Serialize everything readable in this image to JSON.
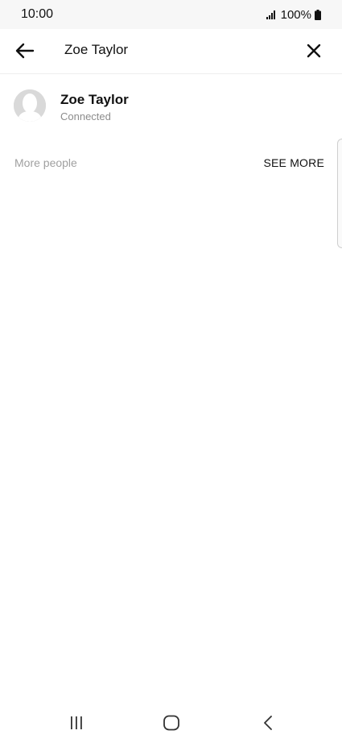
{
  "status_bar": {
    "time": "10:00",
    "battery": "100%",
    "icons": [
      "signal-icon",
      "battery-icon"
    ]
  },
  "search": {
    "query": "Zoe Taylor",
    "back_icon": "arrow-left-icon",
    "close_icon": "close-icon"
  },
  "results": [
    {
      "name": "Zoe Taylor",
      "status": "Connected",
      "avatar_icon": "default-avatar-icon"
    }
  ],
  "more_people": {
    "label": "More people",
    "action": "SEE MORE"
  },
  "nav_bar": {
    "icons": [
      "recent-apps-icon",
      "home-icon",
      "back-icon"
    ]
  },
  "colors": {
    "background": "#ffffff",
    "status_bar_bg": "#f7f7f7",
    "text_primary": "#111111",
    "text_secondary": "#8c8c8c",
    "section_label": "#a0a0a0"
  }
}
